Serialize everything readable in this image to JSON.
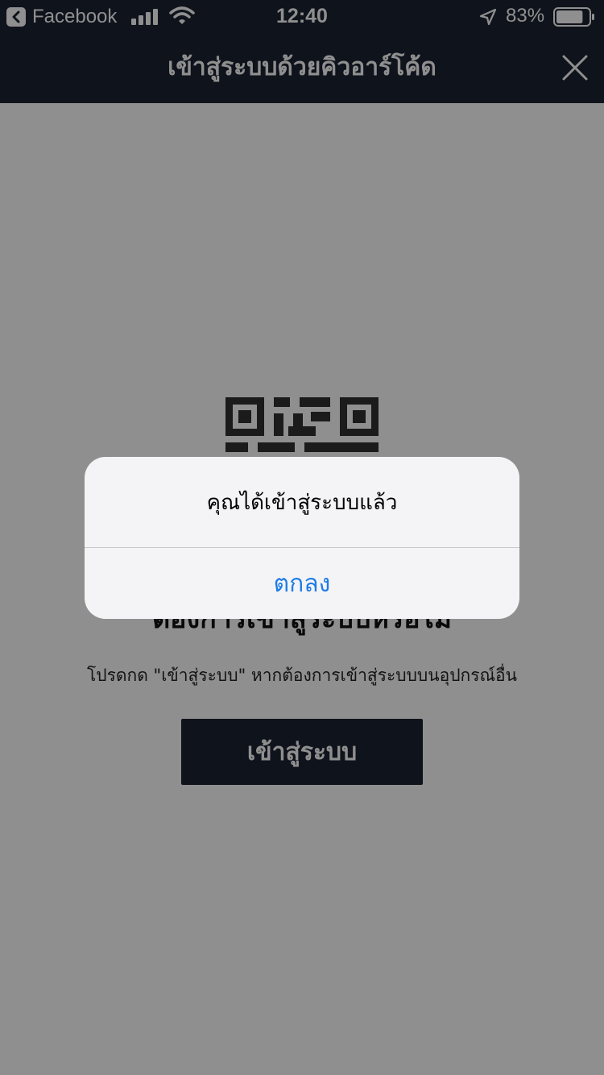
{
  "status_bar": {
    "back_app": "Facebook",
    "time": "12:40",
    "battery_percent": "83%",
    "battery_level": 0.83,
    "icons": [
      "back-arrow-icon",
      "signal-icon",
      "wifi-icon",
      "location-arrow-icon",
      "battery-icon"
    ]
  },
  "nav": {
    "title": "เข้าสู่ระบบด้วยคิวอาร์โค้ด",
    "close_icon": "close-icon"
  },
  "content": {
    "qr_icon": "qr-code-icon",
    "heading": "ต้องการเข้าสู่ระบบหรือไม่",
    "instruction": "โปรดกด \"เข้าสู่ระบบ\" หากต้องการเข้าสู่ระบบบนอุปกรณ์อื่น",
    "login_button": "เข้าสู่ระบบ"
  },
  "alert": {
    "message": "คุณได้เข้าสู่ระบบแล้ว",
    "ok_button": "ตกลง"
  },
  "colors": {
    "header_bg": "#1c2233",
    "overlay": "rgba(0,0,0,0.44)",
    "alert_bg": "#f4f4f6",
    "alert_button": "#1e7ce6"
  }
}
